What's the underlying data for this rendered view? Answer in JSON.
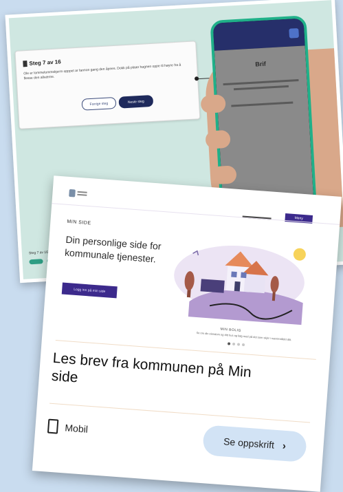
{
  "tutorial": {
    "step_title": "Steg 7 av 16",
    "step_text": "Ole er lommelommskjerm opppet ar fannon gang den åpnes. Dokk på plaan hagnen oppe til høyre fra å flesse den allværne.",
    "prev_label": "Forrige steg",
    "next_label": "Neste steg",
    "phone_heading": "Brif",
    "bottom_label": "Steg 7 av 16"
  },
  "minside": {
    "menu_label": "Meny",
    "kicker": "MIN SIDE",
    "hero_title": "Din personlige side for kommunale tjenester.",
    "hero_button": "Logg inn på min side",
    "caption_title": "MIN BOLIG",
    "caption_text": "Se om din eiendom og ditt hus og følg med på det som skjer i nærområdet ditt.",
    "heading": "Les brev fra kommunen på Min side",
    "device_label": "Mobil",
    "recipe_button": "Se oppskrift"
  },
  "icons": {
    "device": "phone-icon",
    "recipe": "chevron-right-icon"
  },
  "colors": {
    "background": "#c9dcef",
    "tutorial_bg": "#cfe7e1",
    "phone_frame": "#20b089",
    "brand_purple": "#3c2a8c",
    "recipe_button_bg": "#d2e3f5"
  }
}
